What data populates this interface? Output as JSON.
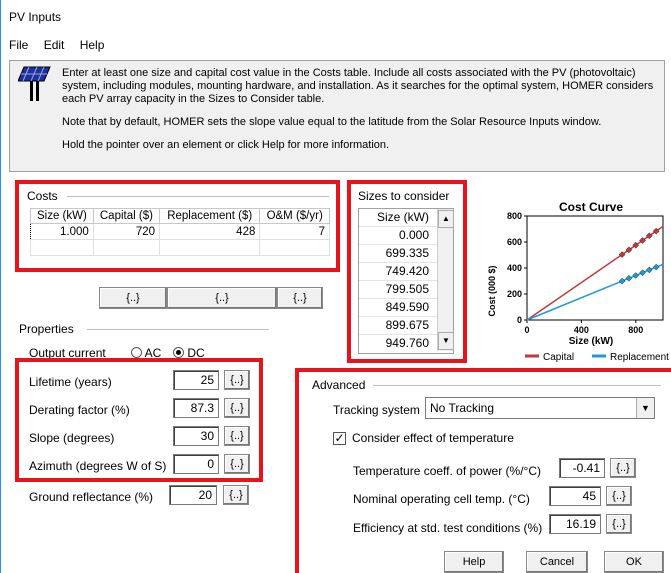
{
  "window": {
    "title": "PV Inputs"
  },
  "menu": [
    "File",
    "Edit",
    "Help"
  ],
  "info": {
    "icon": "solar-panel-icon",
    "p1": "Enter at least one size and capital cost value in the Costs table.  Include all costs associated with the PV (photovoltaic) system, including modules, mounting hardware, and installation. As it searches for the optimal system, HOMER considers each PV array capacity in the Sizes to Consider table.",
    "p2": "Note that by default, HOMER sets the slope value equal to the latitude from the Solar Resource Inputs window.",
    "p3": "Hold the pointer over an element or click Help for more information."
  },
  "costs": {
    "title": "Costs",
    "headers": [
      "Size (kW)",
      "Capital ($)",
      "Replacement ($)",
      "O&M ($/yr)"
    ],
    "rows": [
      [
        "1.000",
        "720",
        "428",
        "7"
      ]
    ],
    "button_label": "{..}"
  },
  "sizes": {
    "title": "Sizes to consider",
    "header": "Size (kW)",
    "values": [
      "0.000",
      "699.335",
      "749.420",
      "799.505",
      "849.590",
      "899.675",
      "949.760"
    ]
  },
  "chart_data": {
    "type": "line",
    "title": "Cost Curve",
    "xlabel": "Size (kW)",
    "ylabel": "Cost (000 $)",
    "xlim": [
      0,
      1000
    ],
    "ylim": [
      0,
      800
    ],
    "xticks": [
      "0",
      "400",
      "800"
    ],
    "yticks": [
      "0",
      "200",
      "400",
      "600",
      "800"
    ],
    "series": [
      {
        "name": "Capital",
        "color": "#c0393b",
        "x": [
          0,
          699.335,
          749.42,
          799.505,
          849.59,
          899.675,
          949.76,
          1000
        ],
        "y": [
          0,
          503.5,
          539.6,
          575.6,
          611.7,
          647.8,
          683.8,
          720
        ]
      },
      {
        "name": "Replacement",
        "color": "#1e9bd7",
        "x": [
          0,
          699.335,
          749.42,
          799.505,
          849.59,
          899.675,
          949.76,
          1000
        ],
        "y": [
          0,
          299.3,
          320.8,
          342.2,
          363.6,
          385.1,
          406.5,
          428
        ]
      }
    ],
    "legend": "bottom"
  },
  "properties": {
    "title": "Properties",
    "output_current_label": "Output current",
    "ac_label": "AC",
    "dc_label": "DC",
    "selected": "DC",
    "lifetime_label": "Lifetime (years)",
    "lifetime": "25",
    "derating_label": "Derating factor (%)",
    "derating": "87.3",
    "slope_label": "Slope (degrees)",
    "slope": "30",
    "azimuth_label": "Azimuth (degrees W of S)",
    "azimuth": "0",
    "ground_label": "Ground reflectance (%)",
    "ground": "20",
    "button_label": "{..}"
  },
  "advanced": {
    "title": "Advanced",
    "tracking_label": "Tracking system",
    "tracking_value": "No Tracking",
    "temp_check_label": "Consider effect of temperature",
    "temp_checked": true,
    "temp_coeff_label": "Temperature coeff. of power (%/°C)",
    "temp_coeff": "-0.41",
    "noct_label": "Nominal operating cell temp. (°C)",
    "noct": "45",
    "eff_label": "Efficiency at std. test conditions (%)",
    "eff": "16.19",
    "button_label": "{..}"
  },
  "footer": {
    "help": "Help",
    "cancel": "Cancel",
    "ok": "OK"
  },
  "colors": {
    "highlight": "#e8141b",
    "capital": "#c0393b",
    "replacement": "#1e9bd7"
  }
}
